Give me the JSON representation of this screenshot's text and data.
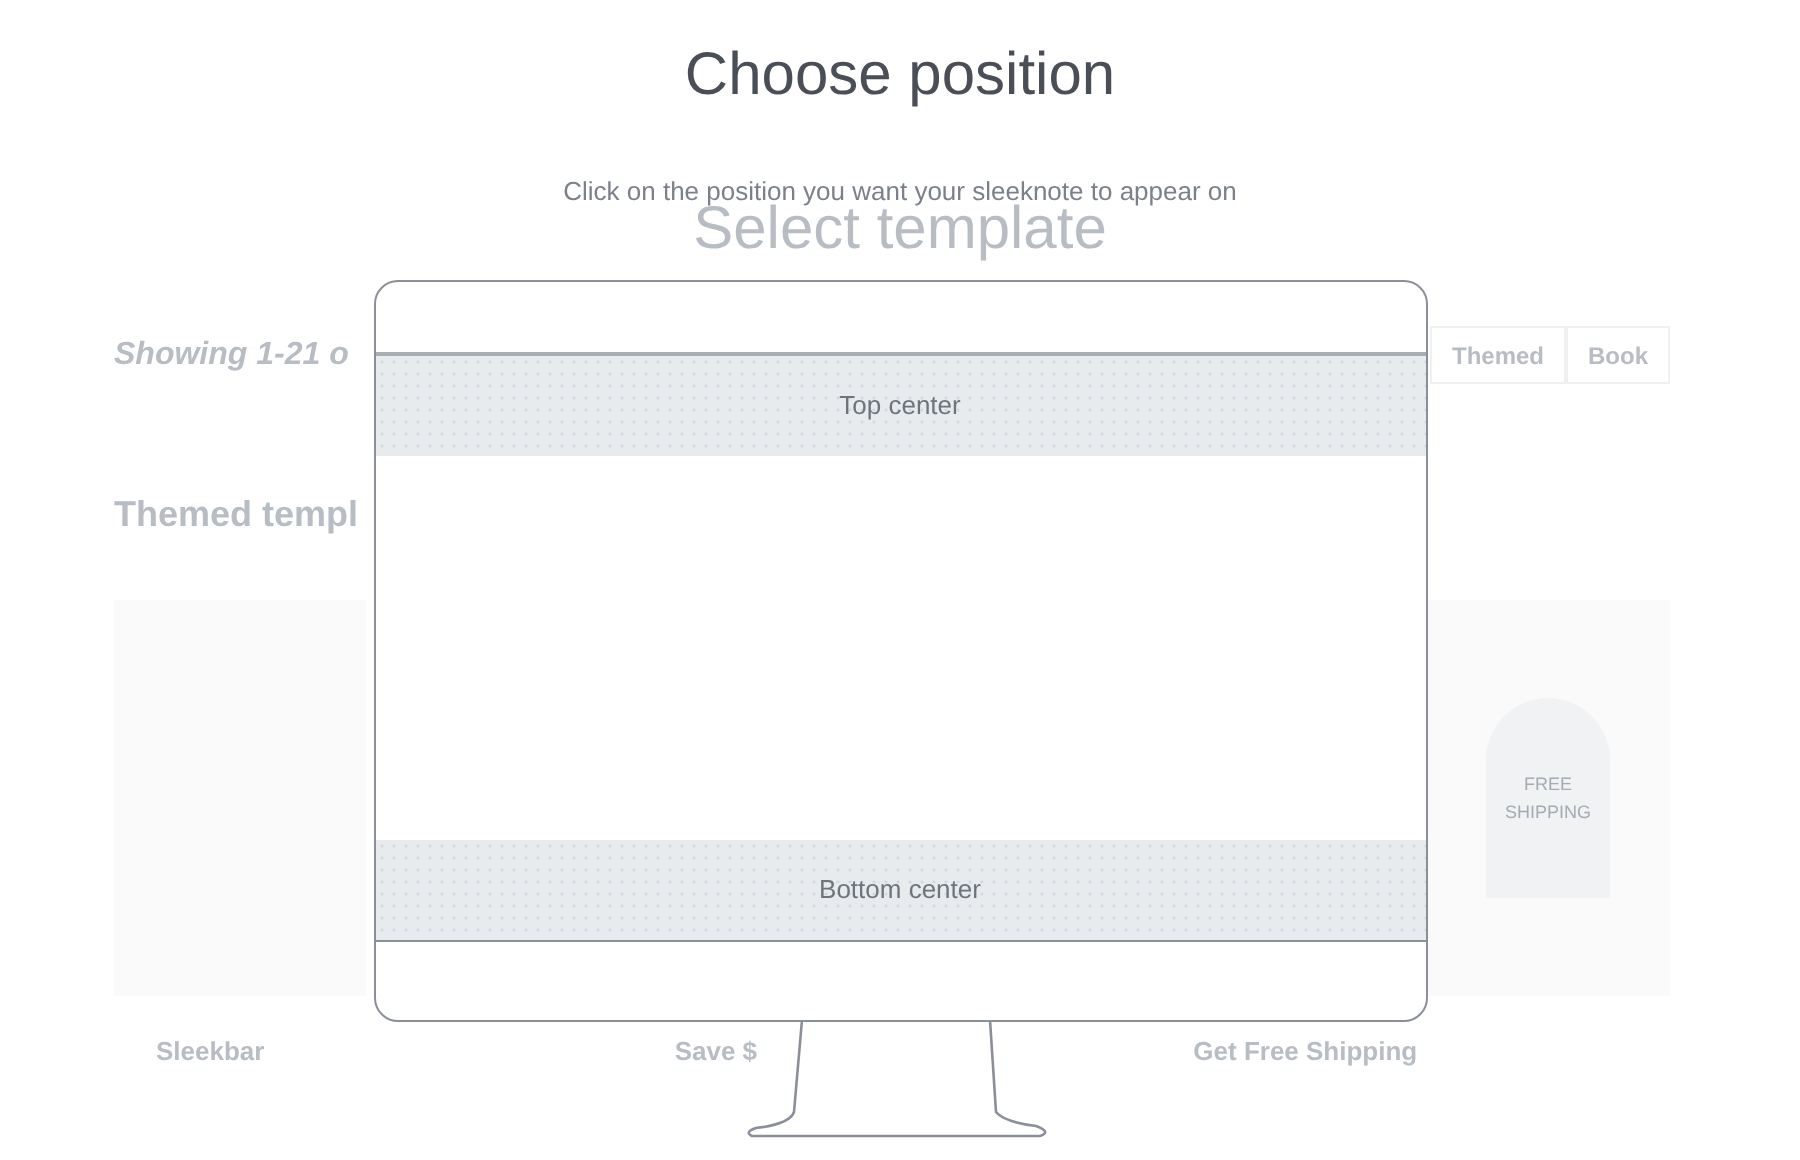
{
  "background": {
    "title": "Select template",
    "showing": "Showing 1-21 o",
    "filters": [
      {
        "label": "Themed"
      },
      {
        "label": "Book"
      }
    ],
    "section_title": "Themed templ",
    "cards": [
      {
        "title": "Sleekbar"
      },
      {
        "title": "Save $"
      },
      {
        "title": "Get Free Shipping",
        "badge": "FREE SHIPPING"
      }
    ]
  },
  "modal": {
    "title": "Choose position",
    "subtitle": "Click on the position you want your sleeknote to appear on",
    "positions": [
      {
        "label": "Top center"
      },
      {
        "label": "Bottom center"
      }
    ]
  }
}
